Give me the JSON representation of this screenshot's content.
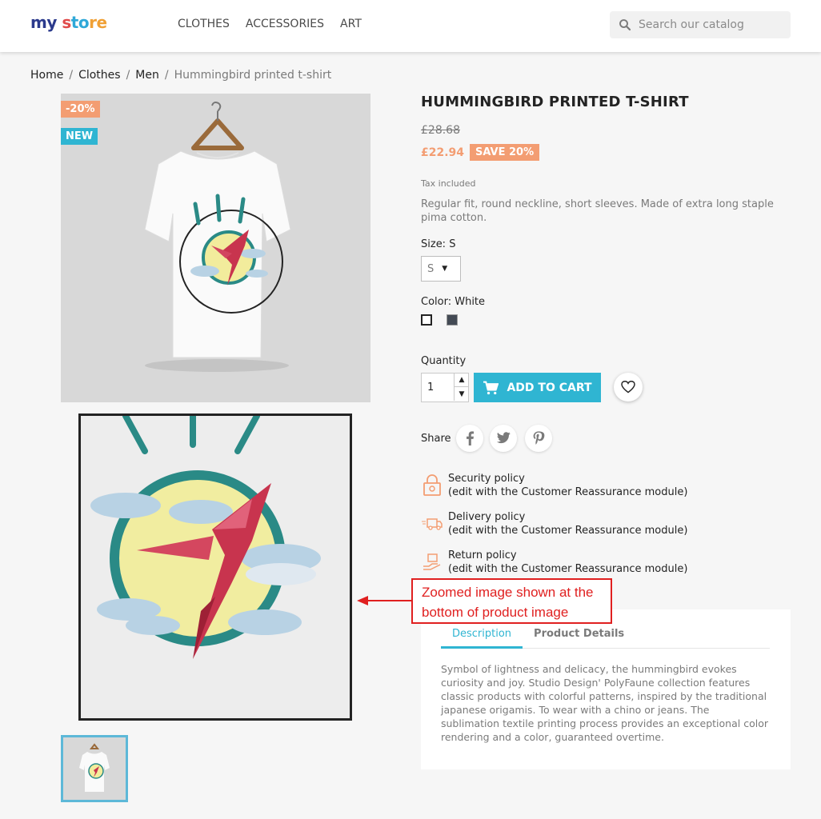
{
  "header": {
    "logo": {
      "part1": "my",
      "part2": "s",
      "part3": "to",
      "part4": "re"
    },
    "nav": [
      "CLOTHES",
      "ACCESSORIES",
      "ART"
    ],
    "search_placeholder": "Search our catalog"
  },
  "breadcrumb": {
    "items": [
      "Home",
      "Clothes",
      "Men"
    ],
    "current": "Hummingbird printed t-shirt",
    "separator": "/"
  },
  "product": {
    "badges": {
      "discount": "-20%",
      "new": "NEW"
    },
    "title": "HUMMINGBIRD PRINTED T-SHIRT",
    "old_price": "£28.68",
    "new_price": "£22.94",
    "save_label": "SAVE 20%",
    "tax_note": "Tax included",
    "short_description": "Regular fit, round neckline, short sleeves. Made of extra long staple pima cotton.",
    "size_label": "Size: S",
    "size_selected": "S",
    "color_label": "Color: White",
    "colors": [
      "#ffffff",
      "#434a54"
    ],
    "quantity_label": "Quantity",
    "quantity_value": "1",
    "add_to_cart": "ADD TO CART",
    "share_label": "Share"
  },
  "reassurance": [
    {
      "title": "Security policy",
      "subtitle": "(edit with the Customer Reassurance module)",
      "icon": "security-lock-icon"
    },
    {
      "title": "Delivery policy",
      "subtitle": "(edit with the Customer Reassurance module)",
      "icon": "delivery-truck-icon"
    },
    {
      "title": "Return policy",
      "subtitle": "(edit with the Customer Reassurance module)",
      "icon": "return-box-icon"
    }
  ],
  "tabs": {
    "description": "Description",
    "details": "Product Details"
  },
  "description_text": "Symbol of lightness and delicacy, the hummingbird evokes curiosity and joy. Studio Design' PolyFaune collection features classic products with colorful patterns, inspired by the traditional japanese origamis. To wear with a chino or jeans. The sublimation textile printing process provides an exceptional color rendering and a color, guaranteed overtime.",
  "annotation": {
    "line1": "Zoomed image shown at the",
    "line2": "bottom of product image"
  },
  "colors": {
    "accent": "#2fb5d2",
    "discount": "#f39d72",
    "annotation": "#e02020"
  }
}
